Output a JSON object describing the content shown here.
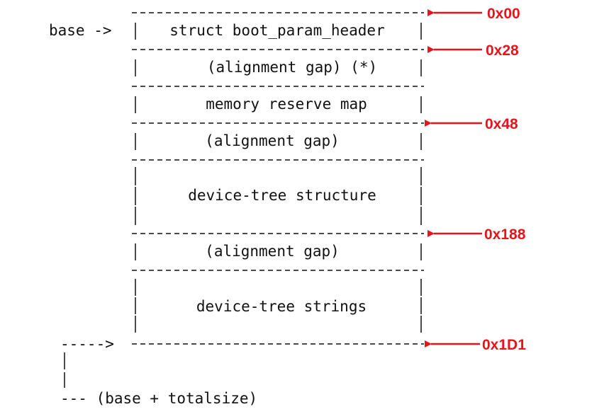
{
  "base_label": "base ->",
  "sections": [
    {
      "label": "struct boot_param_header"
    },
    {
      "label": "(alignment gap) (*)"
    },
    {
      "label": "memory reserve map"
    },
    {
      "label": "(alignment gap)"
    },
    {
      "label": "device-tree structure"
    },
    {
      "label": "(alignment gap)"
    },
    {
      "label": "device-tree strings"
    }
  ],
  "offsets": [
    "0x00",
    "0x28",
    "0x48",
    "0x188",
    "0x1D1"
  ],
  "end_pointer": "----->",
  "end_label": "--- (base + totalsize)",
  "accent_color": "#e8141c"
}
